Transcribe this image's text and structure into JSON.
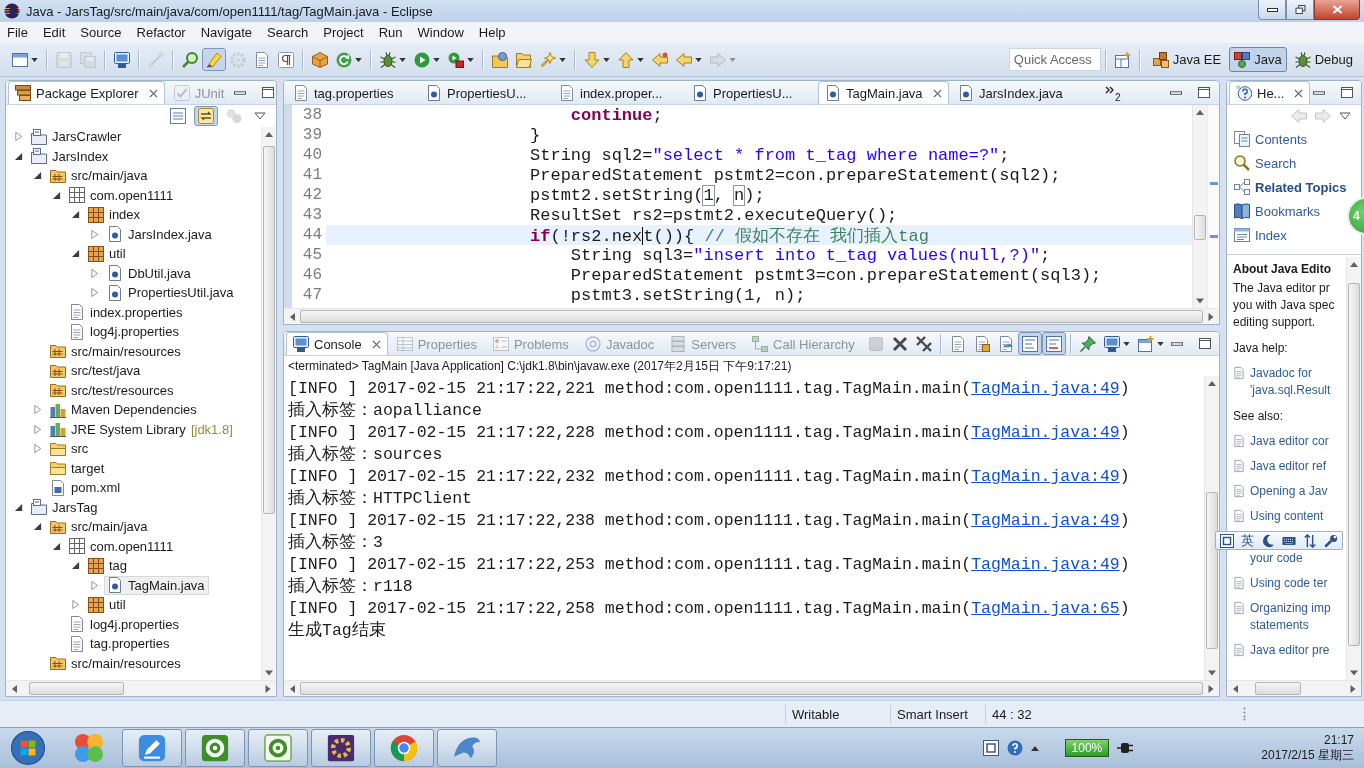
{
  "window": {
    "title": "Java - JarsTag/src/main/java/com/open1111/tag/TagMain.java - Eclipse"
  },
  "menu": [
    "File",
    "Edit",
    "Source",
    "Refactor",
    "Navigate",
    "Search",
    "Project",
    "Run",
    "Window",
    "Help"
  ],
  "toolbar": [
    {
      "kind": "new",
      "dropdown": true,
      "disabled": false,
      "pressed": false
    },
    {
      "kind": "separator"
    },
    {
      "kind": "save",
      "dropdown": false,
      "disabled": true,
      "pressed": false
    },
    {
      "kind": "save-all",
      "dropdown": false,
      "disabled": true,
      "pressed": false
    },
    {
      "kind": "separator"
    },
    {
      "kind": "console",
      "dropdown": false,
      "disabled": false,
      "pressed": false
    },
    {
      "kind": "separator"
    },
    {
      "kind": "breadcrumb",
      "dropdown": false,
      "disabled": true,
      "pressed": false
    },
    {
      "kind": "separator"
    },
    {
      "kind": "open-type",
      "dropdown": false,
      "disabled": false,
      "pressed": false
    },
    {
      "kind": "highlight",
      "dropdown": false,
      "disabled": false,
      "pressed": true
    },
    {
      "kind": "block-select",
      "dropdown": false,
      "disabled": true,
      "pressed": false
    },
    {
      "kind": "show-source",
      "dropdown": false,
      "disabled": false,
      "pressed": false
    },
    {
      "kind": "whitespace",
      "dropdown": false,
      "disabled": false,
      "pressed": false
    },
    {
      "kind": "separator"
    },
    {
      "kind": "build",
      "dropdown": false,
      "disabled": false,
      "pressed": false
    },
    {
      "kind": "refresh",
      "dropdown": true,
      "disabled": false,
      "pressed": false
    },
    {
      "kind": "separator"
    },
    {
      "kind": "debug",
      "dropdown": true,
      "disabled": false,
      "pressed": false
    },
    {
      "kind": "run",
      "dropdown": true,
      "disabled": false,
      "pressed": false
    },
    {
      "kind": "external",
      "dropdown": true,
      "disabled": false,
      "pressed": false
    },
    {
      "kind": "separator"
    },
    {
      "kind": "open-project",
      "dropdown": false,
      "disabled": false,
      "pressed": false
    },
    {
      "kind": "open-folder",
      "dropdown": false,
      "disabled": false,
      "pressed": false
    },
    {
      "kind": "search",
      "dropdown": true,
      "disabled": false,
      "pressed": false
    },
    {
      "kind": "separator"
    },
    {
      "kind": "next",
      "dropdown": true,
      "disabled": false,
      "pressed": false
    },
    {
      "kind": "previous",
      "dropdown": true,
      "disabled": false,
      "pressed": false
    },
    {
      "kind": "last-edit",
      "dropdown": false,
      "disabled": false,
      "pressed": false
    },
    {
      "kind": "back",
      "dropdown": true,
      "disabled": false,
      "pressed": false
    },
    {
      "kind": "forward",
      "dropdown": true,
      "disabled": true,
      "pressed": false
    }
  ],
  "quick_access": {
    "placeholder": "Quick Access"
  },
  "perspectives": [
    {
      "label": "Java EE",
      "kind": "java-ee",
      "selected": false
    },
    {
      "label": "Java",
      "kind": "java",
      "selected": true
    },
    {
      "label": "Debug",
      "kind": "debug",
      "selected": false
    }
  ],
  "package_explorer": {
    "tabs": [
      {
        "label": "Package Explorer",
        "kind": "packages",
        "selected": true
      },
      {
        "label": "JUnit",
        "kind": "junit",
        "selected": false
      }
    ],
    "toolbar": [
      {
        "kind": "collapse-all",
        "dropdown": false,
        "disabled": false,
        "pressed": false
      },
      {
        "kind": "link-editor",
        "dropdown": false,
        "disabled": false,
        "pressed": true
      },
      {
        "kind": "focus",
        "dropdown": false,
        "disabled": true,
        "pressed": false
      },
      {
        "kind": "view-menu",
        "dropdown": false,
        "disabled": false,
        "pressed": false
      }
    ],
    "tree": [
      {
        "label": "JarsCrawler",
        "kind": "project",
        "expanded": false,
        "selected": false
      },
      {
        "label": "JarsIndex",
        "kind": "project",
        "expanded": true,
        "selected": false,
        "children": [
          {
            "label": "src/main/java",
            "kind": "source-folder",
            "expanded": true,
            "selected": false,
            "children": [
              {
                "label": "com.open1111",
                "kind": "package-empty",
                "expanded": true,
                "selected": false,
                "children": [
                  {
                    "label": "index",
                    "kind": "package",
                    "expanded": true,
                    "selected": false,
                    "children": [
                      {
                        "label": "JarsIndex.java",
                        "kind": "java",
                        "expanded": false,
                        "selected": false
                      }
                    ]
                  },
                  {
                    "label": "util",
                    "kind": "package",
                    "expanded": true,
                    "selected": false,
                    "children": [
                      {
                        "label": "DbUtil.java",
                        "kind": "java",
                        "expanded": false,
                        "selected": false
                      },
                      {
                        "label": "PropertiesUtil.java",
                        "kind": "java",
                        "expanded": false,
                        "selected": false
                      }
                    ]
                  }
                ]
              },
              {
                "label": "index.properties",
                "kind": "file",
                "selected": false
              },
              {
                "label": "log4j.properties",
                "kind": "file",
                "selected": false
              }
            ]
          },
          {
            "label": "src/main/resources",
            "kind": "source-folder",
            "selected": false
          },
          {
            "label": "src/test/java",
            "kind": "source-folder",
            "selected": false
          },
          {
            "label": "src/test/resources",
            "kind": "source-folder",
            "selected": false
          },
          {
            "label": "Maven Dependencies",
            "kind": "library",
            "expanded": false,
            "selected": false
          },
          {
            "label": "JRE System Library",
            "decoration": "[jdk1.8]",
            "kind": "library",
            "expanded": false,
            "selected": false
          },
          {
            "label": "src",
            "kind": "folder",
            "expanded": false,
            "selected": false
          },
          {
            "label": "target",
            "kind": "folder",
            "selected": false
          },
          {
            "label": "pom.xml",
            "kind": "xml",
            "selected": false
          }
        ]
      },
      {
        "label": "JarsTag",
        "kind": "project",
        "expanded": true,
        "selected": false,
        "children": [
          {
            "label": "src/main/java",
            "kind": "source-folder",
            "expanded": true,
            "selected": false,
            "children": [
              {
                "label": "com.open1111",
                "kind": "package-empty",
                "expanded": true,
                "selected": false,
                "children": [
                  {
                    "label": "tag",
                    "kind": "package",
                    "expanded": true,
                    "selected": false,
                    "children": [
                      {
                        "label": "TagMain.java",
                        "kind": "java",
                        "expanded": false,
                        "selected": true
                      }
                    ]
                  },
                  {
                    "label": "util",
                    "kind": "package",
                    "expanded": false,
                    "selected": false
                  }
                ]
              },
              {
                "label": "log4j.properties",
                "kind": "file",
                "selected": false
              },
              {
                "label": "tag.properties",
                "kind": "file",
                "selected": false
              }
            ]
          },
          {
            "label": "src/main/resources",
            "kind": "source-folder",
            "selected": false
          }
        ]
      }
    ]
  },
  "editor": {
    "tabs": [
      {
        "label": "tag.properties",
        "kind": "properties-file",
        "selected": false
      },
      {
        "label": "PropertiesU...",
        "kind": "java",
        "selected": false
      },
      {
        "label": "index.proper...",
        "kind": "properties-file",
        "selected": false
      },
      {
        "label": "PropertiesU...",
        "kind": "java",
        "selected": false
      },
      {
        "label": "TagMain.java",
        "kind": "java",
        "selected": true
      },
      {
        "label": "JarsIndex.java",
        "kind": "java",
        "selected": false
      }
    ],
    "overflow_count": "2",
    "lines": [
      {
        "children": [
          {
            "number": "38",
            "current": false,
            "tokens": [
              {
                "kind": "keyword",
                "text": "continue"
              },
              {
                "kind": "plain",
                "text": ";"
              }
            ]
          }
        ]
      },
      {
        "number": "39",
        "current": false,
        "tokens": [
          {
            "kind": "plain",
            "text": "}"
          }
        ]
      },
      {
        "number": "40",
        "current": false,
        "tokens": [
          {
            "kind": "plain",
            "text": "String sql2="
          },
          {
            "kind": "string",
            "text": "\"select * from t_tag where name=?\""
          },
          {
            "kind": "plain",
            "text": ";"
          }
        ]
      },
      {
        "number": "41",
        "current": false,
        "tokens": [
          {
            "kind": "plain",
            "text": "PreparedStatement pstmt2=con.prepareStatement(sql2);"
          }
        ]
      },
      {
        "number": "42",
        "current": false,
        "tokens": [
          {
            "kind": "plain",
            "text": "pstmt2.setString("
          },
          {
            "kind": "linked",
            "text": "1"
          },
          {
            "kind": "plain",
            "text": ", "
          },
          {
            "kind": "linked",
            "text": "n"
          },
          {
            "kind": "plain",
            "text": ");"
          }
        ]
      },
      {
        "number": "43",
        "current": false,
        "tokens": [
          {
            "kind": "plain",
            "text": "ResultSet rs2=pstmt2.executeQuery();"
          }
        ]
      },
      {
        "number": "44",
        "current": true,
        "tokens": [
          {
            "kind": "keyword",
            "text": "if"
          },
          {
            "kind": "plain",
            "text": "(!rs2.nex"
          },
          {
            "kind": "caret"
          },
          {
            "kind": "plain",
            "text": "t()){ "
          },
          {
            "kind": "comment",
            "text": "// 假如不存在 我们插入tag"
          }
        ],
        "children": [
          {
            "number": "45",
            "current": false,
            "tokens": [
              {
                "kind": "plain",
                "text": "String sql3="
              },
              {
                "kind": "string",
                "text": "\"insert into t_tag values(null,?)\""
              },
              {
                "kind": "plain",
                "text": ";"
              }
            ]
          },
          {
            "number": "46",
            "current": false,
            "tokens": [
              {
                "kind": "plain",
                "text": "PreparedStatement pstmt3=con.prepareStatement(sql3);"
              }
            ]
          },
          {
            "number": "47",
            "current": false,
            "tokens": [
              {
                "kind": "plain",
                "text": "pstmt3.setString(1, n);"
              }
            ]
          }
        ]
      }
    ]
  },
  "console": {
    "tabs": [
      {
        "label": "Console",
        "kind": "console",
        "selected": true
      },
      {
        "label": "Properties",
        "kind": "properties-view",
        "selected": false
      },
      {
        "label": "Problems",
        "kind": "problems",
        "selected": false
      },
      {
        "label": "Javadoc",
        "kind": "javadoc",
        "selected": false
      },
      {
        "label": "Servers",
        "kind": "servers",
        "selected": false
      },
      {
        "label": "Call Hierarchy",
        "kind": "call-hierarchy",
        "selected": false
      }
    ],
    "toolbar": [
      {
        "kind": "terminate",
        "dropdown": false,
        "disabled": true,
        "pressed": false
      },
      {
        "kind": "remove-launch",
        "dropdown": false,
        "disabled": false,
        "pressed": false
      },
      {
        "kind": "remove-all",
        "dropdown": false,
        "disabled": false,
        "pressed": false
      },
      {
        "kind": "separator"
      },
      {
        "kind": "clear",
        "dropdown": false,
        "disabled": false,
        "pressed": false
      },
      {
        "kind": "scroll-lock",
        "dropdown": false,
        "disabled": false,
        "pressed": false
      },
      {
        "kind": "word-wrap",
        "dropdown": false,
        "disabled": false,
        "pressed": false
      },
      {
        "kind": "show-stdout",
        "dropdown": false,
        "disabled": false,
        "pressed": true
      },
      {
        "kind": "show-stderr",
        "dropdown": false,
        "disabled": false,
        "pressed": true
      },
      {
        "kind": "separator"
      },
      {
        "kind": "pin",
        "dropdown": false,
        "disabled": false,
        "pressed": false
      },
      {
        "kind": "display-console",
        "dropdown": true,
        "disabled": false,
        "pressed": false
      },
      {
        "kind": "open-console",
        "dropdown": true,
        "disabled": false,
        "pressed": false
      }
    ],
    "header": "<terminated> TagMain [Java Application] C:\\jdk1.8\\bin\\javaw.exe (2017年2月15日 下午9:17:21)",
    "lines": [
      {
        "kind": "log",
        "text": "[INFO ] 2017-02-15 21:17:22,221 method:com.open1111.tag.TagMain.main(",
        "link": "TagMain.java:49",
        "tail": ")"
      },
      {
        "kind": "plain",
        "text": "插入标签：aopalliance"
      },
      {
        "kind": "log",
        "text": "[INFO ] 2017-02-15 21:17:22,228 method:com.open1111.tag.TagMain.main(",
        "link": "TagMain.java:49",
        "tail": ")"
      },
      {
        "kind": "plain",
        "text": "插入标签：sources"
      },
      {
        "kind": "log",
        "text": "[INFO ] 2017-02-15 21:17:22,232 method:com.open1111.tag.TagMain.main(",
        "link": "TagMain.java:49",
        "tail": ")"
      },
      {
        "kind": "plain",
        "text": "插入标签：HTTPClient"
      },
      {
        "kind": "log",
        "text": "[INFO ] 2017-02-15 21:17:22,238 method:com.open1111.tag.TagMain.main(",
        "link": "TagMain.java:49",
        "tail": ")"
      },
      {
        "kind": "plain",
        "text": "插入标签：3"
      },
      {
        "kind": "log",
        "text": "[INFO ] 2017-02-15 21:17:22,253 method:com.open1111.tag.TagMain.main(",
        "link": "TagMain.java:49",
        "tail": ")"
      },
      {
        "kind": "plain",
        "text": "插入标签：r118"
      },
      {
        "kind": "log",
        "text": "[INFO ] 2017-02-15 21:17:22,258 method:com.open1111.tag.TagMain.main(",
        "link": "TagMain.java:65",
        "tail": ")"
      },
      {
        "kind": "plain",
        "text": "生成Tag结束"
      }
    ]
  },
  "help": {
    "tab": {
      "label": "He...",
      "selected": true
    },
    "toolbar": [
      {
        "kind": "back",
        "dropdown": false,
        "disabled": true,
        "pressed": false
      },
      {
        "kind": "forward",
        "dropdown": false,
        "disabled": true,
        "pressed": false
      },
      {
        "kind": "view-menu",
        "dropdown": false,
        "disabled": false,
        "pressed": false
      }
    ],
    "nav": [
      {
        "label": "Contents",
        "kind": "contents",
        "selected": false
      },
      {
        "label": "Search",
        "kind": "search",
        "selected": false
      },
      {
        "label": "Related Topics",
        "kind": "related",
        "selected": true
      },
      {
        "label": "Bookmarks",
        "kind": "bookmarks",
        "selected": false
      },
      {
        "label": "Index",
        "kind": "index",
        "selected": false
      }
    ],
    "title": "About Java Edito",
    "description": [
      "The Java editor pr",
      "you with Java spec",
      "editing support."
    ],
    "sections": [
      {
        "heading": "Java help:",
        "links": [
          {
            "kind": "link",
            "lines": [
              "Javadoc for",
              "'java.sql.Result"
            ]
          }
        ]
      },
      {
        "heading": "See also:",
        "links": [
          {
            "kind": "link",
            "lines": [
              "Java editor cor"
            ]
          },
          {
            "kind": "link",
            "lines": [
              "Java editor ref"
            ]
          },
          {
            "kind": "link",
            "lines": [
              "Opening a Jav"
            ]
          },
          {
            "kind": "link",
            "lines": [
              "Using content"
            ]
          },
          {
            "kind": "continuation",
            "lines": [
              "your code"
            ]
          },
          {
            "kind": "link",
            "lines": [
              "Using code ter"
            ]
          },
          {
            "kind": "link",
            "lines": [
              "Organizing imp",
              "statements"
            ]
          },
          {
            "kind": "link",
            "lines": [
              "Java editor pre"
            ]
          }
        ]
      }
    ]
  },
  "ime_bar": {
    "mode": "英"
  },
  "floating_badge": {
    "text": "4"
  },
  "status_bar": [
    "Writable",
    "Smart Insert",
    "44 : 32"
  ],
  "taskbar": {
    "apps": [
      {
        "kind": "balls",
        "running": false
      },
      {
        "kind": "writer",
        "running": true
      },
      {
        "kind": "recorder",
        "running": true
      },
      {
        "kind": "studio",
        "running": true
      },
      {
        "kind": "ide",
        "running": true
      },
      {
        "kind": "browser",
        "running": true
      },
      {
        "kind": "dolphin",
        "running": true
      }
    ],
    "tray": {
      "battery": "100%",
      "time": "21:17",
      "date": "2017/2/15 星期三"
    }
  }
}
